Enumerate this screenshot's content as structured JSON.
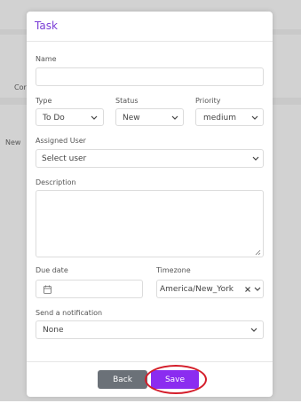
{
  "background": {
    "left_text_1": "Cor",
    "left_text_2": "New"
  },
  "modal": {
    "title": "Task",
    "name": {
      "label": "Name",
      "value": ""
    },
    "type": {
      "label": "Type",
      "value": "To Do"
    },
    "status": {
      "label": "Status",
      "value": "New"
    },
    "priority": {
      "label": "Priority",
      "value": "medium"
    },
    "assigned_user": {
      "label": "Assigned User",
      "value": "Select user"
    },
    "description": {
      "label": "Description",
      "value": ""
    },
    "due_date": {
      "label": "Due date",
      "value": ""
    },
    "timezone": {
      "label": "Timezone",
      "value": "America/New_York"
    },
    "notification": {
      "label": "Send a notification",
      "value": "None"
    },
    "back_label": "Back",
    "save_label": "Save"
  },
  "colors": {
    "accent": "#8b2cf0",
    "title": "#7a3dd6",
    "back_button": "#6b7178",
    "highlight": "#d41d2a"
  },
  "icons": [
    "chevron-down-icon",
    "calendar-icon",
    "clear-icon",
    "resize-handle-icon"
  ]
}
